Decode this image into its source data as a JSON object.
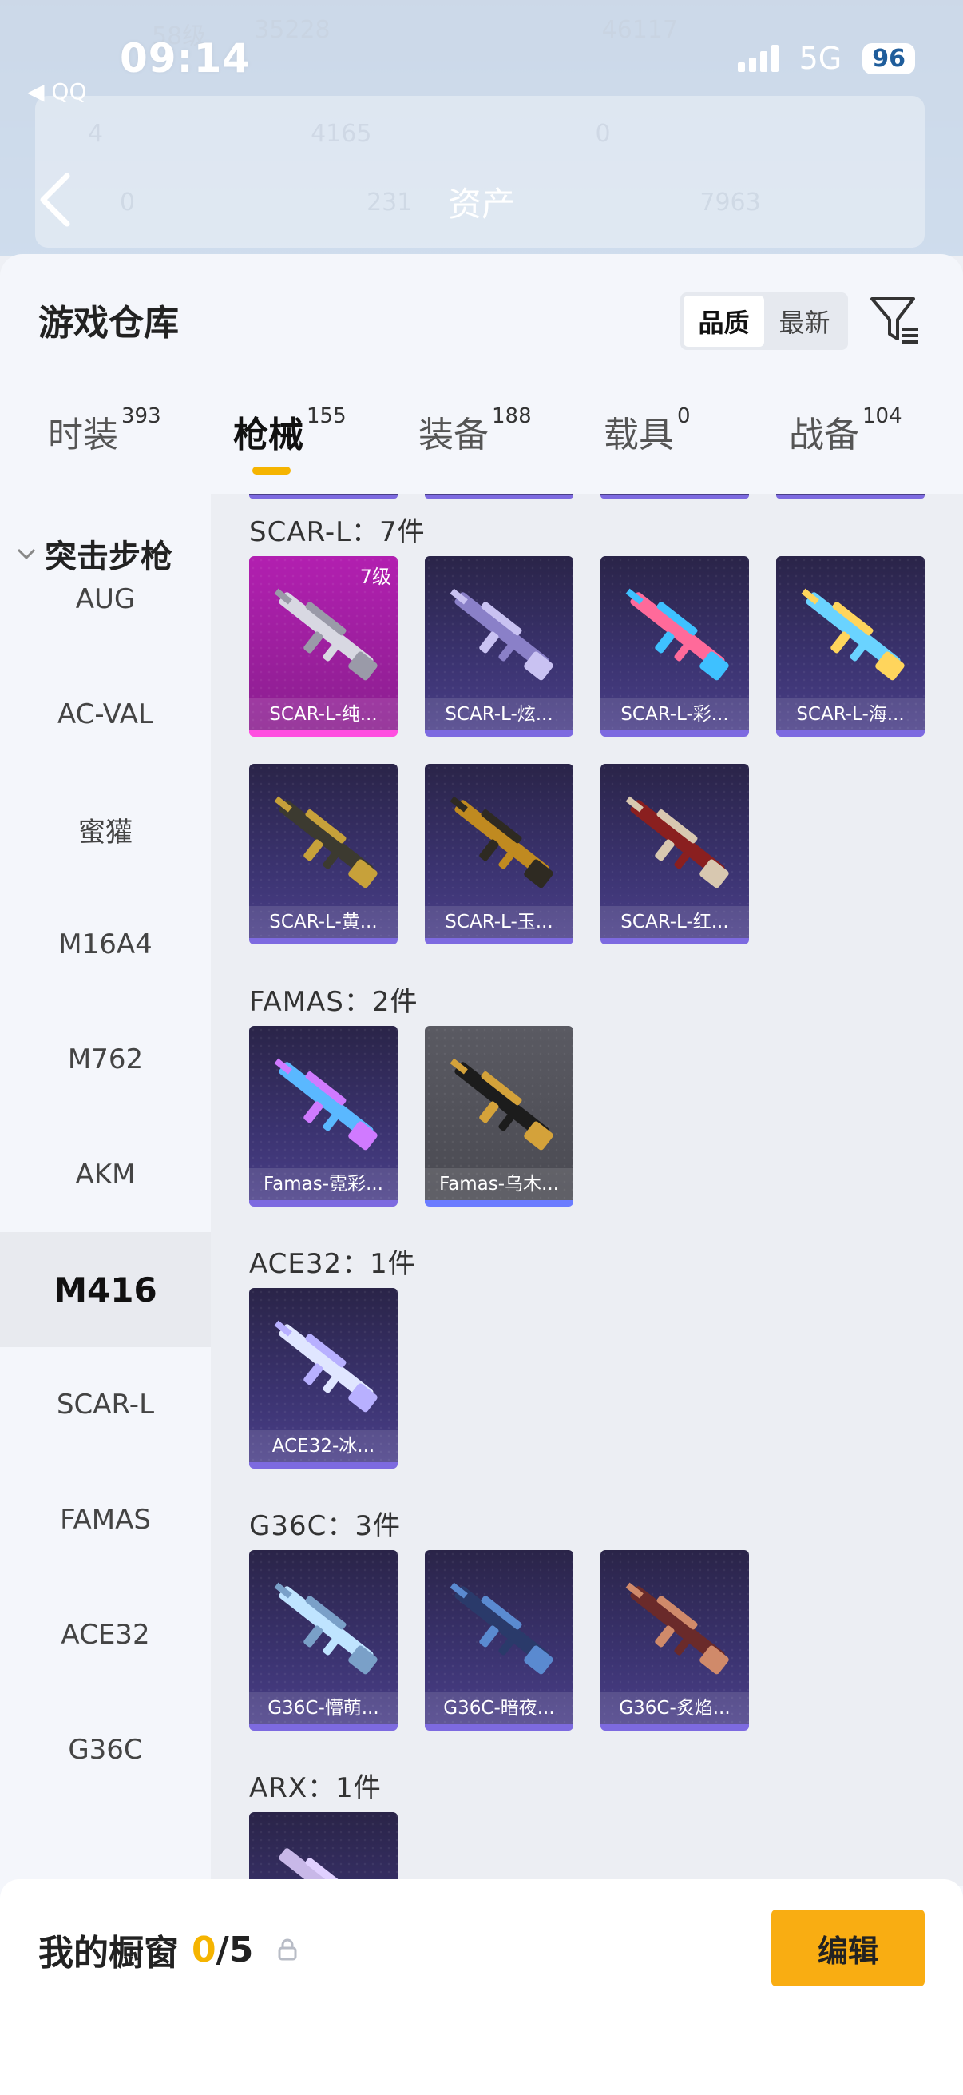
{
  "status_bar": {
    "time": "09:14",
    "network": "5G",
    "battery": "96",
    "back_app": "◀ QQ"
  },
  "header": {
    "title": "资产",
    "ghost_values": [
      "58级",
      "35228",
      "46117",
      "4",
      "4165",
      "0",
      "0",
      "231",
      "7963"
    ]
  },
  "sheet": {
    "title": "游戏仓库"
  },
  "sort": {
    "options": [
      "品质",
      "最新"
    ],
    "selected": "品质"
  },
  "tabs": [
    {
      "label": "时装",
      "count": "393"
    },
    {
      "label": "枪械",
      "count": "155",
      "active": true
    },
    {
      "label": "装备",
      "count": "188"
    },
    {
      "label": "载具",
      "count": "0"
    },
    {
      "label": "战备",
      "count": "104"
    }
  ],
  "side_nav": {
    "category": "突击步枪",
    "items": [
      "AUG",
      "AC-VAL",
      "蜜獾",
      "M16A4",
      "M762",
      "AKM",
      "M416",
      "SCAR-L",
      "FAMAS",
      "ACE32",
      "G36C"
    ],
    "selected": "M416"
  },
  "sections": [
    {
      "title": "SCAR-L：7件",
      "items": [
        {
          "name": "SCAR-L-纯...",
          "level": "7级",
          "style": "pink"
        },
        {
          "name": "SCAR-L-炫...",
          "style": "purple"
        },
        {
          "name": "SCAR-L-彩...",
          "style": "purple"
        },
        {
          "name": "SCAR-L-海...",
          "style": "purple"
        },
        {
          "name": "SCAR-L-黄...",
          "style": "purple"
        },
        {
          "name": "SCAR-L-玉...",
          "style": "purple"
        },
        {
          "name": "SCAR-L-红...",
          "style": "purple"
        }
      ]
    },
    {
      "title": "FAMAS：2件",
      "items": [
        {
          "name": "Famas-霓彩...",
          "style": "purple"
        },
        {
          "name": "Famas-乌木...",
          "style": "gray"
        }
      ]
    },
    {
      "title": "ACE32：1件",
      "items": [
        {
          "name": "ACE32-冰...",
          "style": "purple"
        }
      ]
    },
    {
      "title": "G36C：3件",
      "items": [
        {
          "name": "G36C-懵萌...",
          "style": "purple"
        },
        {
          "name": "G36C-暗夜...",
          "style": "purple"
        },
        {
          "name": "G36C-炙焰...",
          "style": "purple"
        }
      ]
    },
    {
      "title": "ARX：1件",
      "items": []
    }
  ],
  "bottom": {
    "label": "我的橱窗",
    "current": "0",
    "total": "/5",
    "edit": "编辑"
  },
  "colors": {
    "accent": "#f9ad12",
    "purple_card": "#3b3370",
    "pink_card": "#b21fb0"
  }
}
